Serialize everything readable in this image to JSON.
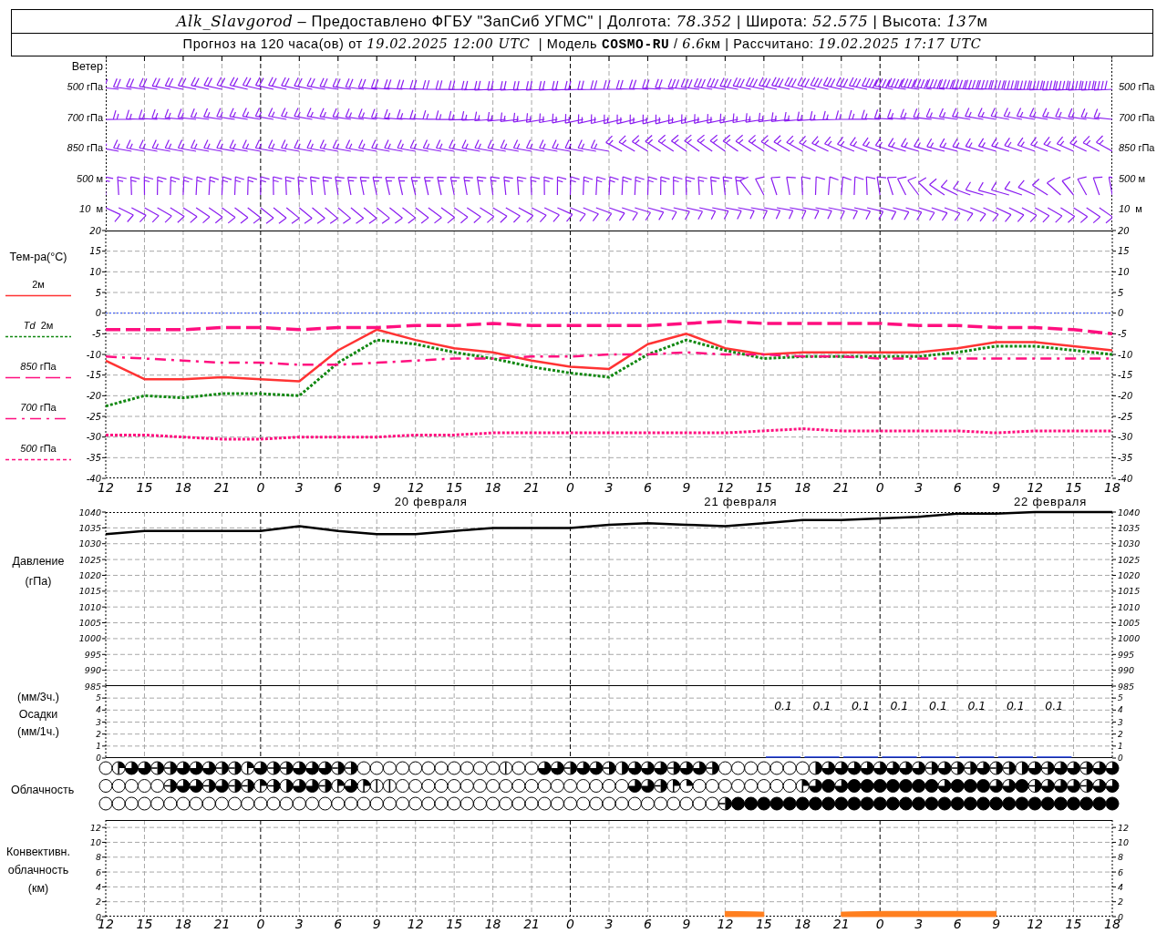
{
  "header": {
    "lines": [
      [
        {
          "text": "Alk_Slavgorod",
          "kind": "italic"
        },
        {
          "text": " – Предоставлено ФГБУ \"ЗапСиб УГМС\" | Долгота: ",
          "kind": "plain"
        },
        {
          "text": "78.352",
          "kind": "italic"
        },
        {
          "text": " | Широта: ",
          "kind": "plain"
        },
        {
          "text": "52.575",
          "kind": "italic"
        },
        {
          "text": " | Высота: ",
          "kind": "plain"
        },
        {
          "text": "137",
          "kind": "italic"
        },
        {
          "text": "м",
          "kind": "plain"
        }
      ],
      [
        {
          "text": "Прогноз на 120 часа(ов) от ",
          "kind": "plain"
        },
        {
          "text": "19.02.2025 12:00 UTC",
          "kind": "italic"
        },
        {
          "text": "  | Модель ",
          "kind": "plain"
        },
        {
          "text": "COSMO-RU",
          "kind": "bold"
        },
        {
          "text": " / ",
          "kind": "plain"
        },
        {
          "text": "6.6",
          "kind": "italic"
        },
        {
          "text": "км | Рассчитано: ",
          "kind": "plain"
        },
        {
          "text": "19.02.2025 17:17 UTC",
          "kind": "italic"
        }
      ]
    ]
  },
  "wind": {
    "title": "Ветер",
    "levels": [
      {
        "label_left": "*500* гПа",
        "label_right": "*500* гПа"
      },
      {
        "label_left": "*700* гПа",
        "label_right": "*700* гПа"
      },
      {
        "label_left": "*850* гПа",
        "label_right": "*850* гПа"
      },
      {
        "label_left": "*500* м",
        "label_right": "*500* м"
      },
      {
        "label_left": "*10*  м",
        "label_right": "*10*  м"
      }
    ]
  },
  "temperature": {
    "title": "Тем-ра(°C)",
    "legend": [
      {
        "label": "2м",
        "kind": "solid"
      },
      {
        "label": "*Td*  2м",
        "kind": "dashed"
      },
      {
        "label": "*850* гПа",
        "kind": "longdash"
      },
      {
        "label": "*700* гПа",
        "kind": "dashdot"
      },
      {
        "label": "*500* гПа",
        "kind": "dotted"
      }
    ],
    "date_labels": [
      "20 февраля",
      "21 февраля",
      "22 февраля"
    ],
    "right_ticks": [
      "20",
      "15",
      "10",
      "5",
      "0",
      "-5",
      "-10",
      "-15",
      "-20",
      "-25",
      "-30",
      "-35",
      "-40"
    ],
    "chart_data": {
      "type": "line",
      "grid": true,
      "ylim": [
        -40,
        20
      ],
      "categories": [
        "12",
        "15",
        "18",
        "21",
        "0",
        "3",
        "6",
        "9",
        "12",
        "15",
        "18",
        "21",
        "0",
        "3",
        "6",
        "9",
        "12",
        "15",
        "18",
        "21",
        "0",
        "3",
        "6",
        "9",
        "12",
        "15",
        "18"
      ],
      "yticks": [
        -40,
        -35,
        -30,
        -25,
        -20,
        -15,
        -10,
        -5,
        0,
        5,
        10,
        15,
        20
      ],
      "ref_lines": [
        {
          "axis": "y",
          "value": 0,
          "color": "#2a4cff"
        }
      ],
      "series": [
        {
          "color": "#ff3333",
          "line_style": "solid",
          "values": [
            -11.5,
            -16,
            -16,
            -15.5,
            -16,
            -16.5,
            -9,
            -4,
            -6.5,
            -8.5,
            -9.5,
            -11.5,
            -13,
            -13.5,
            -7.5,
            -5,
            -8.5,
            -10,
            -9.5,
            -9.5,
            -9.5,
            -9.5,
            -8.5,
            -7,
            -7,
            -8,
            -9
          ]
        },
        {
          "color": "#118811",
          "line_style": "dotted",
          "values": [
            -22.5,
            -20,
            -20.5,
            -19.5,
            -19.5,
            -20,
            -12,
            -6.5,
            -7.5,
            -9.5,
            -11,
            -13,
            -14.5,
            -15.5,
            -10,
            -6.5,
            -9,
            -11,
            -10.5,
            -10.5,
            -10.5,
            -10.5,
            -9.5,
            -8,
            -8,
            -9,
            -10
          ]
        },
        {
          "color": "#ff0f7f",
          "line_style": "dashed",
          "values": [
            -4,
            -4,
            -4,
            -3.5,
            -3.5,
            -4,
            -3.5,
            -3.5,
            -3,
            -3,
            -2.5,
            -3,
            -3,
            -3,
            -3,
            -2.5,
            -2,
            -2.5,
            -2.5,
            -2.5,
            -2.5,
            -3,
            -3,
            -3.5,
            -3.5,
            -4,
            -5
          ]
        },
        {
          "color": "#ff0f7f",
          "line_style": "dashdot",
          "values": [
            -10.5,
            -11,
            -11.5,
            -12,
            -12,
            -12.5,
            -12.5,
            -12,
            -11.5,
            -11,
            -11,
            -10.5,
            -10.5,
            -10,
            -10,
            -9.5,
            -10,
            -10,
            -10.5,
            -10.5,
            -11,
            -11,
            -11,
            -11,
            -11,
            -11,
            -11
          ]
        },
        {
          "color": "#ff0f7f",
          "line_style": "dotted",
          "values": [
            -29.5,
            -29.5,
            -30,
            -30.5,
            -30.5,
            -30,
            -30,
            -30,
            -29.5,
            -29.5,
            -29,
            -29,
            -29,
            -29,
            -29,
            -29,
            -29,
            -28.5,
            -28,
            -28.5,
            -28.5,
            -28.5,
            -28.5,
            -29,
            -28.5,
            -28.5,
            -28.5
          ]
        }
      ]
    }
  },
  "pressure": {
    "labels": [
      "Давление",
      "(гПа)"
    ],
    "right_ticks": [
      "1040",
      "1035",
      "1030",
      "1025",
      "1020",
      "1015",
      "1010",
      "1005",
      "1000",
      "995",
      "990",
      "985"
    ],
    "chart_data": {
      "type": "line",
      "grid": true,
      "ylim": [
        985,
        1040
      ],
      "categories": [
        null,
        null,
        null,
        null,
        null,
        null,
        null,
        null,
        null,
        null,
        null,
        null,
        null,
        null,
        null,
        null,
        null,
        null,
        null,
        null,
        null,
        null,
        null,
        null,
        null,
        null,
        null
      ],
      "yticks": [
        985,
        990,
        995,
        1000,
        1005,
        1010,
        1015,
        1020,
        1025,
        1030,
        1035,
        1040
      ],
      "series": [
        {
          "color": "#000000",
          "line_style": "solid",
          "values": [
            1033,
            1034,
            1034,
            1034,
            1034,
            1035.5,
            1034,
            1033,
            1033,
            1034,
            1035,
            1035,
            1035,
            1036,
            1036.5,
            1036,
            1035.5,
            1036.5,
            1037.5,
            1037.5,
            1038,
            1038.5,
            1039.5,
            1039.5,
            1040,
            1040,
            1040
          ]
        }
      ]
    }
  },
  "precipitation": {
    "labels": [
      "(мм/3ч.)",
      "Осадки",
      "(мм/1ч.)"
    ],
    "right_ticks": [
      "5",
      "4",
      "3",
      "2",
      "1",
      "0"
    ],
    "chart_data": {
      "type": "bar",
      "grid": true,
      "ylim": [
        0,
        6
      ],
      "yticks": [
        0,
        1,
        2,
        3,
        4,
        5
      ],
      "categories": [
        null,
        null,
        null,
        null,
        null,
        null,
        null,
        null,
        null,
        null,
        null,
        null,
        null,
        null,
        null,
        null,
        null,
        null,
        null,
        null,
        null,
        null,
        null,
        null,
        null,
        null
      ],
      "series": [
        {
          "color": "#2040e0",
          "values": [
            null,
            null,
            null,
            null,
            null,
            null,
            null,
            null,
            null,
            null,
            null,
            null,
            null,
            null,
            null,
            null,
            null,
            0.1,
            0.1,
            0.1,
            0.1,
            0.1,
            0.1,
            0.1,
            0.1,
            null
          ]
        }
      ],
      "value_labels": [
        null,
        null,
        null,
        null,
        null,
        null,
        null,
        null,
        null,
        null,
        null,
        null,
        null,
        null,
        null,
        null,
        null,
        "0.1",
        "0.1",
        "0.1",
        "0.1",
        "0.1",
        "0.1",
        "0.1",
        "0.1",
        null
      ]
    }
  },
  "cloud_cover": {
    "title": "Облачность",
    "rows": [
      {
        "cells": [
          {
            "kind": "okta0"
          },
          {
            "kind": "okta3"
          },
          {
            "kind": "okta6"
          },
          {
            "kind": "okta6"
          },
          {
            "kind": "okta5"
          },
          {
            "kind": "okta5"
          },
          {
            "kind": "okta6"
          },
          {
            "kind": "okta6"
          },
          {
            "kind": "okta6"
          },
          {
            "kind": "okta5"
          },
          {
            "kind": "okta5"
          },
          {
            "kind": "okta3"
          },
          {
            "kind": "okta6"
          },
          {
            "kind": "okta5"
          },
          {
            "kind": "okta5"
          },
          {
            "kind": "okta6"
          },
          {
            "kind": "okta6"
          },
          {
            "kind": "okta6"
          },
          {
            "kind": "okta5"
          },
          {
            "kind": "okta5"
          },
          {
            "kind": "okta0"
          },
          {
            "kind": "okta0"
          },
          {
            "kind": "okta0"
          },
          {
            "kind": "okta0"
          },
          {
            "kind": "okta0"
          },
          {
            "kind": "okta0"
          },
          {
            "kind": "okta0"
          },
          {
            "kind": "okta0"
          },
          {
            "kind": "okta0"
          },
          {
            "kind": "okta0"
          },
          {
            "kind": "okta0"
          },
          {
            "kind": "okta1"
          },
          {
            "kind": "okta0"
          },
          {
            "kind": "okta0"
          },
          {
            "kind": "okta6"
          },
          {
            "kind": "okta6"
          },
          {
            "kind": "okta5"
          },
          {
            "kind": "okta6"
          },
          {
            "kind": "okta6"
          },
          {
            "kind": "okta5"
          },
          {
            "kind": "okta4"
          },
          {
            "kind": "okta6"
          },
          {
            "kind": "okta6"
          },
          {
            "kind": "okta6"
          },
          {
            "kind": "okta5"
          },
          {
            "kind": "okta6"
          },
          {
            "kind": "okta6"
          },
          {
            "kind": "okta5"
          },
          {
            "kind": "okta0"
          },
          {
            "kind": "okta0"
          },
          {
            "kind": "okta0"
          },
          {
            "kind": "okta0"
          },
          {
            "kind": "okta0"
          },
          {
            "kind": "okta0"
          },
          {
            "kind": "okta0"
          },
          {
            "kind": "okta4"
          },
          {
            "kind": "okta6"
          },
          {
            "kind": "okta6"
          },
          {
            "kind": "okta6"
          },
          {
            "kind": "okta6"
          },
          {
            "kind": "okta6"
          },
          {
            "kind": "okta6"
          },
          {
            "kind": "okta6"
          },
          {
            "kind": "okta6"
          },
          {
            "kind": "okta5"
          },
          {
            "kind": "okta6"
          },
          {
            "kind": "okta5"
          },
          {
            "kind": "okta5"
          },
          {
            "kind": "okta6"
          },
          {
            "kind": "okta5"
          },
          {
            "kind": "okta5"
          },
          {
            "kind": "okta4"
          },
          {
            "kind": "okta6"
          },
          {
            "kind": "okta5"
          },
          {
            "kind": "okta6"
          },
          {
            "kind": "okta6"
          },
          {
            "kind": "okta5"
          },
          {
            "kind": "okta6"
          },
          {
            "kind": "okta6"
          }
        ]
      },
      {
        "cells": [
          {
            "kind": "okta0"
          },
          {
            "kind": "okta0"
          },
          {
            "kind": "okta0"
          },
          {
            "kind": "okta0"
          },
          {
            "kind": "okta0"
          },
          {
            "kind": "okta5"
          },
          {
            "kind": "okta6"
          },
          {
            "kind": "okta6"
          },
          {
            "kind": "okta5"
          },
          {
            "kind": "okta6"
          },
          {
            "kind": "okta5"
          },
          {
            "kind": "okta5"
          },
          {
            "kind": "okta3"
          },
          {
            "kind": "okta5"
          },
          {
            "kind": "okta4"
          },
          {
            "kind": "okta6"
          },
          {
            "kind": "okta6"
          },
          {
            "kind": "okta5"
          },
          {
            "kind": "okta3"
          },
          {
            "kind": "okta6"
          },
          {
            "kind": "okta3"
          },
          {
            "kind": "okta1"
          },
          {
            "kind": "okta1"
          },
          {
            "kind": "okta0"
          },
          {
            "kind": "okta0"
          },
          {
            "kind": "okta0"
          },
          {
            "kind": "okta0"
          },
          {
            "kind": "okta0"
          },
          {
            "kind": "okta0"
          },
          {
            "kind": "okta0"
          },
          {
            "kind": "okta0"
          },
          {
            "kind": "okta0"
          },
          {
            "kind": "okta0"
          },
          {
            "kind": "okta0"
          },
          {
            "kind": "okta0"
          },
          {
            "kind": "okta0"
          },
          {
            "kind": "okta0"
          },
          {
            "kind": "okta0"
          },
          {
            "kind": "okta0"
          },
          {
            "kind": "okta0"
          },
          {
            "kind": "okta0"
          },
          {
            "kind": "okta6"
          },
          {
            "kind": "okta6"
          },
          {
            "kind": "okta5"
          },
          {
            "kind": "okta3"
          },
          {
            "kind": "okta2"
          },
          {
            "kind": "okta0"
          },
          {
            "kind": "okta0"
          },
          {
            "kind": "okta0"
          },
          {
            "kind": "okta0"
          },
          {
            "kind": "okta0"
          },
          {
            "kind": "okta0"
          },
          {
            "kind": "okta0"
          },
          {
            "kind": "okta0"
          },
          {
            "kind": "okta3"
          },
          {
            "kind": "okta6"
          },
          {
            "kind": "okta8"
          },
          {
            "kind": "okta6"
          },
          {
            "kind": "okta8"
          },
          {
            "kind": "okta8"
          },
          {
            "kind": "okta8"
          },
          {
            "kind": "okta8"
          },
          {
            "kind": "okta8"
          },
          {
            "kind": "okta8"
          },
          {
            "kind": "okta8"
          },
          {
            "kind": "okta6"
          },
          {
            "kind": "okta8"
          },
          {
            "kind": "okta8"
          },
          {
            "kind": "okta8"
          },
          {
            "kind": "okta6"
          },
          {
            "kind": "okta6"
          },
          {
            "kind": "okta8"
          },
          {
            "kind": "okta5"
          },
          {
            "kind": "okta6"
          },
          {
            "kind": "okta6"
          },
          {
            "kind": "okta6"
          },
          {
            "kind": "okta5"
          },
          {
            "kind": "okta6"
          },
          {
            "kind": "okta6"
          }
        ]
      },
      {
        "cells": [
          {
            "kind": "okta0"
          },
          {
            "kind": "okta0"
          },
          {
            "kind": "okta0"
          },
          {
            "kind": "okta0"
          },
          {
            "kind": "okta0"
          },
          {
            "kind": "okta0"
          },
          {
            "kind": "okta0"
          },
          {
            "kind": "okta0"
          },
          {
            "kind": "okta0"
          },
          {
            "kind": "okta0"
          },
          {
            "kind": "okta0"
          },
          {
            "kind": "okta0"
          },
          {
            "kind": "okta0"
          },
          {
            "kind": "okta0"
          },
          {
            "kind": "okta0"
          },
          {
            "kind": "okta0"
          },
          {
            "kind": "okta0"
          },
          {
            "kind": "okta0"
          },
          {
            "kind": "okta0"
          },
          {
            "kind": "okta0"
          },
          {
            "kind": "okta0"
          },
          {
            "kind": "okta0"
          },
          {
            "kind": "okta0"
          },
          {
            "kind": "okta0"
          },
          {
            "kind": "okta0"
          },
          {
            "kind": "okta0"
          },
          {
            "kind": "okta0"
          },
          {
            "kind": "okta0"
          },
          {
            "kind": "okta0"
          },
          {
            "kind": "okta0"
          },
          {
            "kind": "okta0"
          },
          {
            "kind": "okta0"
          },
          {
            "kind": "okta0"
          },
          {
            "kind": "okta0"
          },
          {
            "kind": "okta0"
          },
          {
            "kind": "okta0"
          },
          {
            "kind": "okta0"
          },
          {
            "kind": "okta0"
          },
          {
            "kind": "okta0"
          },
          {
            "kind": "okta0"
          },
          {
            "kind": "okta0"
          },
          {
            "kind": "okta0"
          },
          {
            "kind": "okta0"
          },
          {
            "kind": "okta0"
          },
          {
            "kind": "okta0"
          },
          {
            "kind": "okta0"
          },
          {
            "kind": "okta0"
          },
          {
            "kind": "okta0"
          },
          {
            "kind": "okta5"
          },
          {
            "kind": "okta8"
          },
          {
            "kind": "okta8"
          },
          {
            "kind": "okta8"
          },
          {
            "kind": "okta8"
          },
          {
            "kind": "okta8"
          },
          {
            "kind": "okta8"
          },
          {
            "kind": "okta8"
          },
          {
            "kind": "okta8"
          },
          {
            "kind": "okta8"
          },
          {
            "kind": "okta8"
          },
          {
            "kind": "okta8"
          },
          {
            "kind": "okta8"
          },
          {
            "kind": "okta8"
          },
          {
            "kind": "okta8"
          },
          {
            "kind": "okta8"
          },
          {
            "kind": "okta8"
          },
          {
            "kind": "okta8"
          },
          {
            "kind": "okta8"
          },
          {
            "kind": "okta8"
          },
          {
            "kind": "okta8"
          },
          {
            "kind": "okta8"
          },
          {
            "kind": "okta8"
          },
          {
            "kind": "okta8"
          },
          {
            "kind": "okta8"
          },
          {
            "kind": "okta8"
          },
          {
            "kind": "okta8"
          },
          {
            "kind": "okta8"
          },
          {
            "kind": "okta8"
          },
          {
            "kind": "okta8"
          },
          {
            "kind": "okta8"
          }
        ]
      }
    ]
  },
  "convective": {
    "labels": [
      "Конвективн.",
      "облачность",
      "(км)"
    ],
    "right_ticks": [
      "12",
      "10",
      "8",
      "6",
      "4",
      "2",
      "0"
    ],
    "chart_data": {
      "type": "area",
      "grid": true,
      "ylim": [
        0,
        13
      ],
      "categories": [
        "12",
        "15",
        "18",
        "21",
        "0",
        "3",
        "6",
        "9",
        "12",
        "15",
        "18",
        "21",
        "0",
        "3",
        "6",
        "9",
        "12",
        "15",
        "18",
        "21",
        "0",
        "3",
        "6",
        "9",
        "12",
        "15",
        "18"
      ],
      "yticks": [
        0,
        2,
        4,
        6,
        8,
        10,
        12
      ],
      "series": [
        {
          "color": "#ff7f1f",
          "values": [
            null,
            null,
            null,
            null,
            null,
            null,
            null,
            null,
            null,
            null,
            null,
            null,
            null,
            null,
            null,
            null,
            0.7,
            0.6,
            null,
            0.6,
            0.7,
            0.7,
            0.7,
            0.7,
            null,
            null,
            null
          ]
        }
      ]
    }
  }
}
